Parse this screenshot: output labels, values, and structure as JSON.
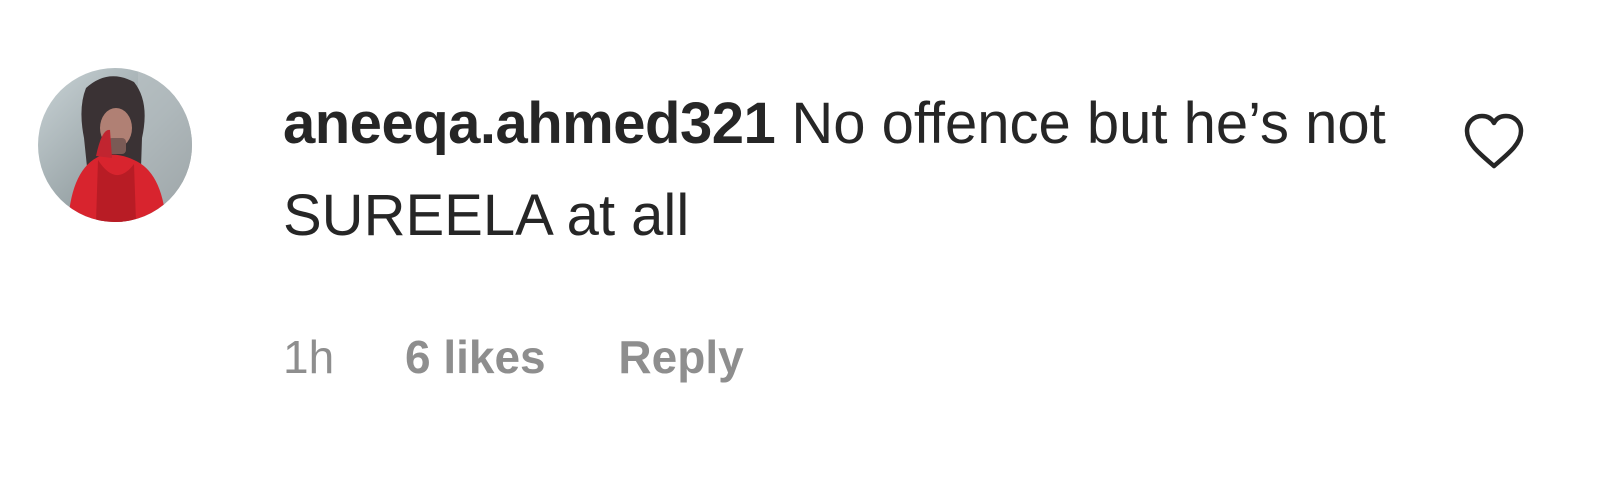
{
  "comment": {
    "username": "aneeqa.ahmed321",
    "text": "No offence but he’s not SUREELA at all",
    "time": "1h",
    "likes": "6 likes",
    "reply_label": "Reply",
    "like_icon": "heart-outline-icon",
    "avatar_icon": "user-avatar-photo"
  },
  "colors": {
    "text_primary": "#262626",
    "text_secondary": "#8e8e8e",
    "background": "#ffffff"
  }
}
